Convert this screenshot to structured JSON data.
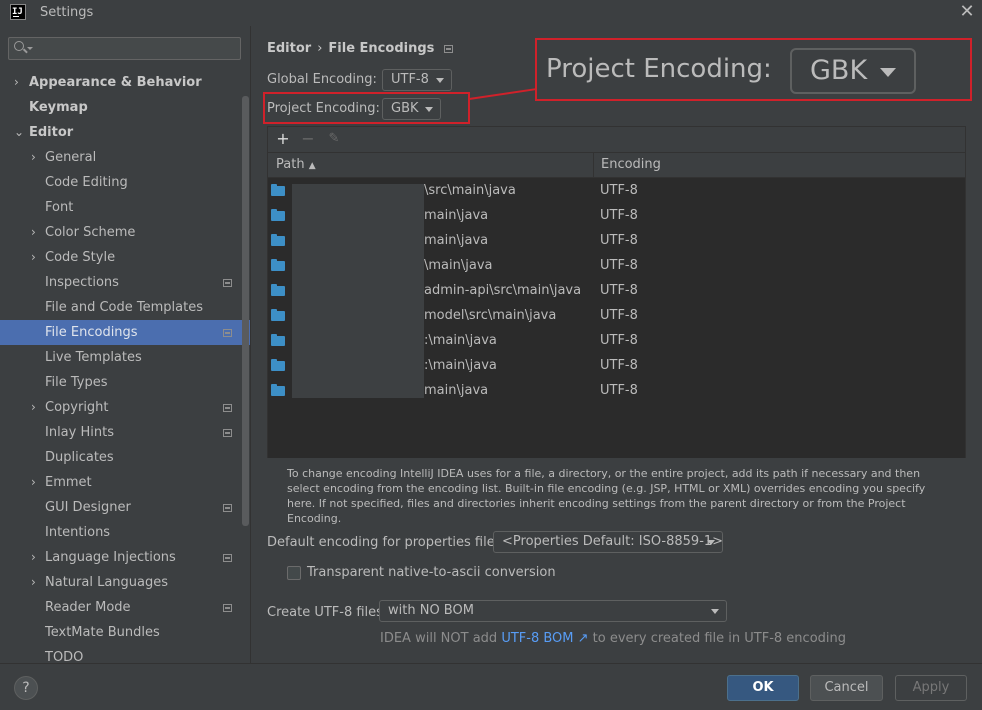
{
  "window": {
    "title": "Settings",
    "close_icon": "close-icon"
  },
  "sidebar": {
    "search_placeholder": "",
    "items": [
      {
        "label": "Appearance & Behavior",
        "chevron": "›"
      },
      {
        "label": "Keymap"
      },
      {
        "label": "Editor",
        "chevron": "⌄"
      },
      {
        "label": "General",
        "chevron": "›"
      },
      {
        "label": "Code Editing"
      },
      {
        "label": "Font"
      },
      {
        "label": "Color Scheme",
        "chevron": "›"
      },
      {
        "label": "Code Style",
        "chevron": "›"
      },
      {
        "label": "Inspections"
      },
      {
        "label": "File and Code Templates"
      },
      {
        "label": "File Encodings"
      },
      {
        "label": "Live Templates"
      },
      {
        "label": "File Types"
      },
      {
        "label": "Copyright",
        "chevron": "›"
      },
      {
        "label": "Inlay Hints"
      },
      {
        "label": "Duplicates"
      },
      {
        "label": "Emmet",
        "chevron": "›"
      },
      {
        "label": "GUI Designer"
      },
      {
        "label": "Intentions"
      },
      {
        "label": "Language Injections",
        "chevron": "›"
      },
      {
        "label": "Natural Languages",
        "chevron": "›"
      },
      {
        "label": "Reader Mode"
      },
      {
        "label": "TextMate Bundles"
      },
      {
        "label": "TODO"
      }
    ]
  },
  "breadcrumb": {
    "parent": "Editor",
    "separator": "›",
    "current": "File Encodings"
  },
  "global_encoding": {
    "label": "Global Encoding:",
    "value": "UTF-8"
  },
  "project_encoding": {
    "label": "Project Encoding:",
    "value": "GBK"
  },
  "toolbar": {
    "add": "+",
    "remove": "−",
    "edit": "✎"
  },
  "table": {
    "columns": [
      "Path",
      "Encoding"
    ],
    "sort_indicator": "▲",
    "rows": [
      {
        "path": "\\src\\main\\java",
        "encoding": "UTF-8"
      },
      {
        "path": "main\\java",
        "encoding": "UTF-8"
      },
      {
        "path": "main\\java",
        "encoding": "UTF-8"
      },
      {
        "path": "\\main\\java",
        "encoding": "UTF-8"
      },
      {
        "path": "admin-api\\src\\main\\java",
        "encoding": "UTF-8"
      },
      {
        "path": "model\\src\\main\\java",
        "encoding": "UTF-8"
      },
      {
        "path": ":\\main\\java",
        "encoding": "UTF-8"
      },
      {
        "path": ":\\main\\java",
        "encoding": "UTF-8"
      },
      {
        "path": "main\\java",
        "encoding": "UTF-8"
      }
    ]
  },
  "note": "To change encoding IntelliJ IDEA uses for a file, a directory, or the entire project, add its path if necessary and then select encoding from the encoding list. Built-in file encoding (e.g. JSP, HTML or XML) overrides encoding you specify here. If not specified, files and directories inherit encoding settings from the parent directory or from the Project Encoding.",
  "properties": {
    "label": "Default encoding for properties files:",
    "value": "<Properties Default: ISO-8859-1>"
  },
  "transparent": {
    "label": "Transparent native-to-ascii conversion",
    "checked": false
  },
  "utf8": {
    "label": "Create UTF-8 files:",
    "value": "with NO BOM",
    "hint_prefix": "IDEA will NOT add",
    "hint_link": "UTF-8 BOM ↗",
    "hint_suffix": "to every created file in UTF-8 encoding"
  },
  "buttons": {
    "help": "?",
    "ok": "OK",
    "cancel": "Cancel",
    "apply": "Apply"
  },
  "colors": {
    "selection": "#4b6eaf",
    "highlight": "#d0212a",
    "ok": "#365880",
    "link": "#589df6"
  }
}
